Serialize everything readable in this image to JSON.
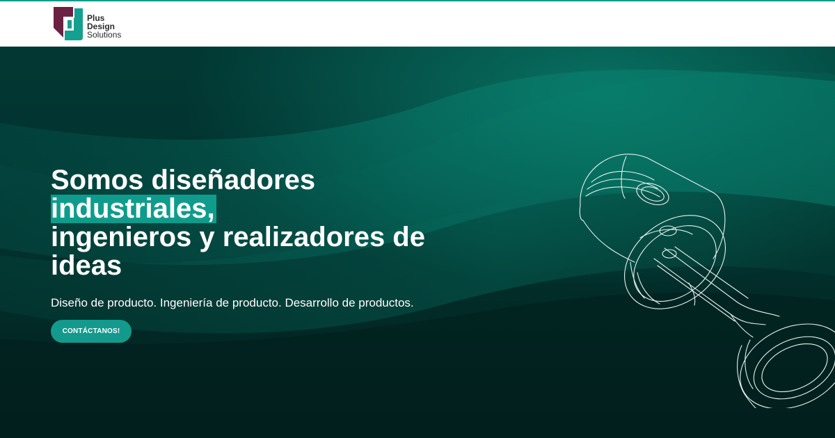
{
  "brand": {
    "name_line1": "Plus",
    "name_line2": "Design",
    "name_line3": "Solutions",
    "colors": {
      "mark_purple": "#6b2142",
      "mark_teal": "#14a091",
      "accent": "#0f9c8c"
    }
  },
  "hero": {
    "headline_line1": "Somos diseñadores",
    "headline_highlight": "industriales,",
    "headline_line3": "ingenieros y realizadores de",
    "headline_line4": "ideas",
    "subtitle": "Diseño de producto. Ingeniería de producto. Desarrollo de productos.",
    "cta_label": "CONTÁCTANOS!",
    "background_color": "#02312d",
    "illustration": "piston-connecting-rod-line-drawing"
  }
}
